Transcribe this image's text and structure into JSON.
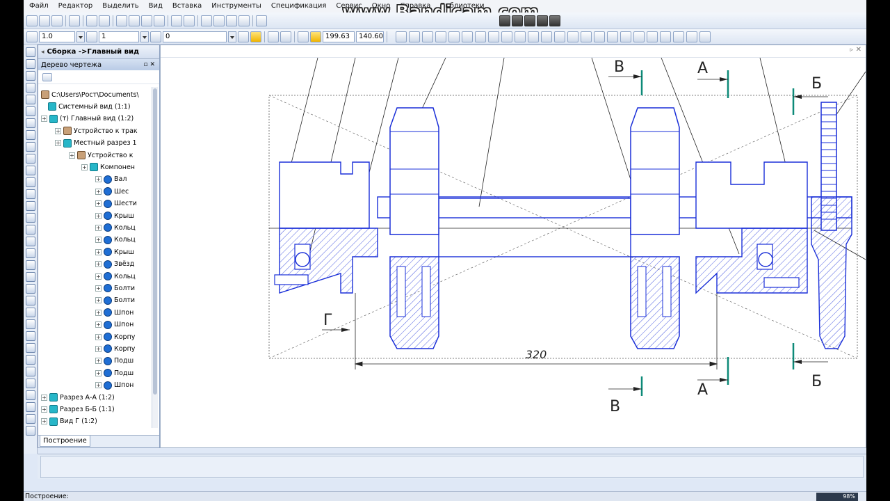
{
  "menu": [
    "Файл",
    "Редактор",
    "Выделить",
    "Вид",
    "Вставка",
    "Инструменты",
    "Спецификация",
    "Сервис",
    "Окно",
    "Справка",
    "Библиотеки"
  ],
  "watermark": "www.Bandicam.com",
  "toolbar2": {
    "scale_value": "1.0",
    "layer_value": "1",
    "style_value": "0",
    "coord_x": "199.63",
    "coord_y": "140.60"
  },
  "tree": {
    "assembly_tab": "Сборка ->Главный вид",
    "caption": "Дерево чертежа",
    "items": [
      {
        "label": "C:\\Users\\Рост\\Documents\\"
      },
      {
        "label": "Системный вид (1:1)"
      },
      {
        "label": "(т) Главный вид (1:2)"
      },
      {
        "label": "Устройство  к трак"
      },
      {
        "label": "Местный разрез 1"
      },
      {
        "label": "Устройство  к"
      },
      {
        "label": "Компонен"
      },
      {
        "label": "Вал"
      },
      {
        "label": "Шес"
      },
      {
        "label": "Шести"
      },
      {
        "label": "Крыш"
      },
      {
        "label": "Кольц"
      },
      {
        "label": "Кольц"
      },
      {
        "label": "Крыш"
      },
      {
        "label": "Звёзд"
      },
      {
        "label": "Кольц"
      },
      {
        "label": "Болти"
      },
      {
        "label": "Болти"
      },
      {
        "label": "Шпон"
      },
      {
        "label": "Шпон"
      },
      {
        "label": "Корпу"
      },
      {
        "label": "Корпу"
      },
      {
        "label": "Подш"
      },
      {
        "label": "Подш"
      },
      {
        "label": "Шпон"
      },
      {
        "label": "Разрез А-А (1:2)"
      },
      {
        "label": "Разрез Б-Б (1:1)"
      },
      {
        "label": "Вид Г (1:2)"
      }
    ],
    "bottom_tab": "Построение"
  },
  "drawing": {
    "dimension_label": "320",
    "section_labels": {
      "v": "В",
      "a": "А",
      "b": "Б",
      "g": "Г"
    }
  },
  "status": {
    "text": "Построение:",
    "zoom": "98%"
  }
}
